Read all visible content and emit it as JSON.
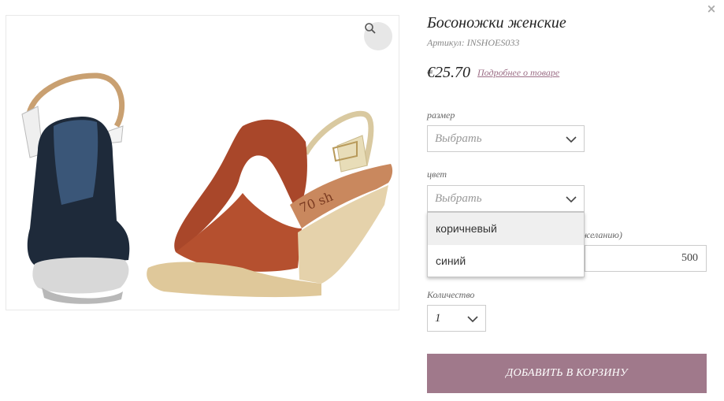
{
  "product": {
    "title": "Босоножки женские",
    "sku": "Артикул: INSHOES033",
    "price": "€25.70",
    "more_link": "Подробнее о товаре"
  },
  "options": {
    "size": {
      "label": "размер",
      "value": "Выбрать"
    },
    "color": {
      "label": "цвет",
      "value": "Выбрать",
      "open_items": [
        "коричневый",
        "синий"
      ],
      "highlighted_index": 0
    },
    "amount": {
      "label_fragment": "желанию)",
      "value": "500"
    },
    "quantity": {
      "label": "Количество",
      "value": "1"
    }
  },
  "actions": {
    "add_to_cart": "ДОБАВИТЬ В КОРЗИНУ",
    "close": "×"
  },
  "icons": {
    "zoom": "magnifier-icon",
    "close": "close-icon",
    "chevron": "chevron-down-icon"
  },
  "colors": {
    "accent": "#a0798b",
    "link": "#9c6e86"
  }
}
